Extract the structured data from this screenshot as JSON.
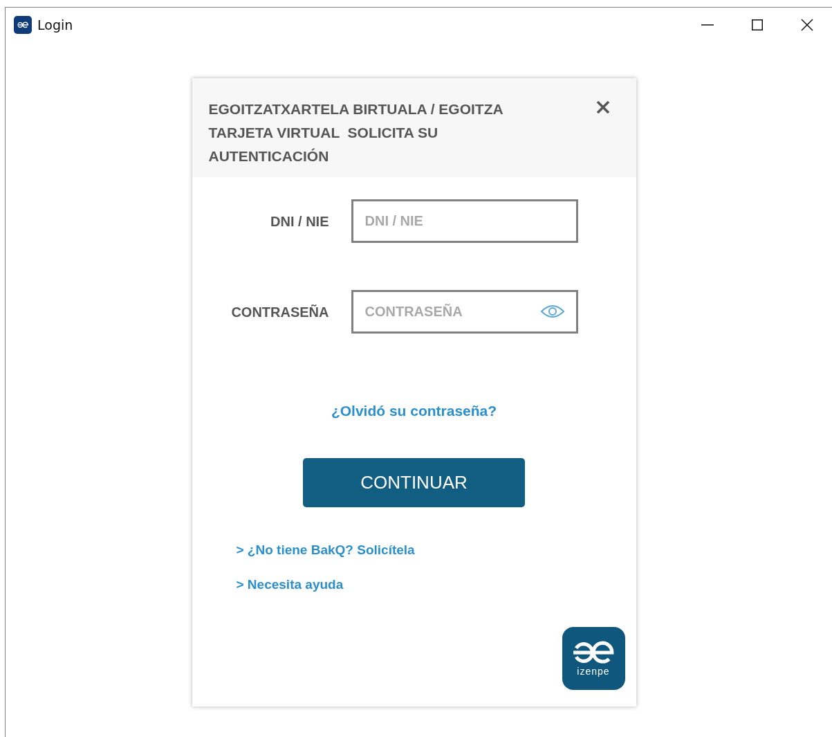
{
  "window": {
    "title": "Login"
  },
  "dialog": {
    "title": "EGOITZATXARTELA BIRTUALA / EGOITZA TARJETA VIRTUAL  SOLICITA SU AUTENTICACIÓN",
    "fields": [
      {
        "kind": "text",
        "label": "DNI / NIE",
        "placeholder": "DNI / NIE"
      },
      {
        "kind": "password",
        "label": "CONTRASEÑA",
        "placeholder": "CONTRASEÑA"
      }
    ],
    "forgot_link": "¿Olvidó su contraseña?",
    "submit": "CONTINUAR",
    "links": [
      "> ¿No tiene BakQ? Solicítela",
      "> Necesita ayuda"
    ],
    "logo_text": "izenpe"
  }
}
